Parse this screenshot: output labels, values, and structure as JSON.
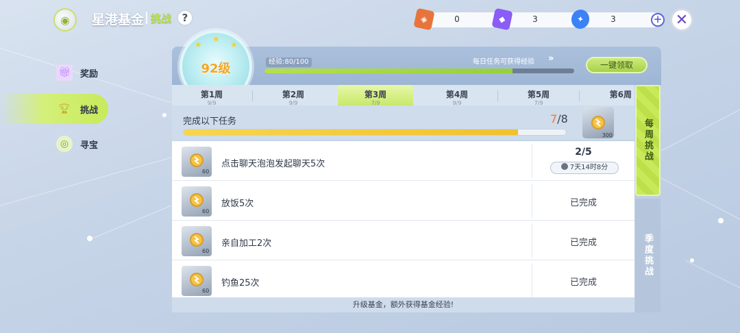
{
  "header": {
    "title": "星港基金",
    "subtitle": "挑战",
    "help_label": "?",
    "close_label": "✕",
    "currencies": [
      {
        "icon": "card-currency-icon",
        "value": "0",
        "color": "#e8743b"
      },
      {
        "icon": "ticket-currency-icon",
        "value": "3",
        "color": "#8b5cf6"
      },
      {
        "icon": "crystal-currency-icon",
        "value": "3",
        "color": "#3b82f6"
      }
    ]
  },
  "nav": {
    "items": [
      {
        "label": "奖励",
        "icon": "gift-icon"
      },
      {
        "label": "挑战",
        "icon": "trophy-icon",
        "active": true
      },
      {
        "label": "寻宝",
        "icon": "coins-icon"
      }
    ]
  },
  "level": {
    "text": "92级",
    "exp_label": "经验:80/100",
    "exp_progress": 0.8,
    "daily_text": "每日任务可获得经验",
    "claim_all": "一键领取"
  },
  "weeks": [
    {
      "label": "第1周",
      "count": "9/9"
    },
    {
      "label": "第2周",
      "count": "9/9"
    },
    {
      "label": "第3周",
      "count": "7/9",
      "active": true
    },
    {
      "label": "第4周",
      "count": "9/9"
    },
    {
      "label": "第5周",
      "count": "7/9"
    },
    {
      "label": "第6周",
      "count": ""
    }
  ],
  "goal": {
    "text": "完成以下任务",
    "current": "7",
    "total": "/8",
    "progress": 0.875,
    "reward_amount": "300"
  },
  "tasks": [
    {
      "name": "点击聊天泡泡发起聊天5次",
      "reward": "60",
      "progress": "2/5",
      "time": "7天14时8分",
      "status": ""
    },
    {
      "name": "放饭5次",
      "reward": "60",
      "status": "已完成"
    },
    {
      "name": "亲自加工2次",
      "reward": "60",
      "status": "已完成"
    },
    {
      "name": "钓鱼25次",
      "reward": "60",
      "status": "已完成"
    }
  ],
  "footer": "升级基金，额外获得基金经验!",
  "side_tabs": {
    "weekly": "每周挑战",
    "season": "季度挑战"
  },
  "colors": {
    "accent_green": "#c8ea5a",
    "accent_orange": "#ef7a2e",
    "progress_yellow": "#f2c12e"
  }
}
